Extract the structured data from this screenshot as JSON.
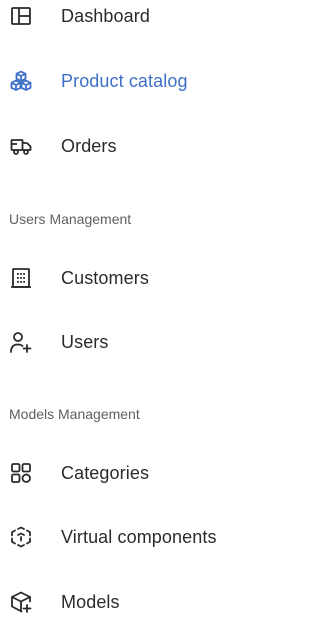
{
  "colors": {
    "text": "#2b2b2b",
    "accent": "#3d6fc8",
    "section_heading": "#5f5f5f",
    "background": "#ffffff"
  },
  "nav": {
    "dashboard": {
      "label": "Dashboard",
      "icon": "dashboard-layout-icon",
      "active": false
    },
    "product_catalog": {
      "label": "Product catalog",
      "icon": "boxes-icon",
      "active": true
    },
    "orders": {
      "label": "Orders",
      "icon": "delivery-truck-icon",
      "active": false
    }
  },
  "sections": {
    "users_management": {
      "title": "Users Management",
      "items": {
        "customers": {
          "label": "Customers",
          "icon": "building-icon"
        },
        "users": {
          "label": "Users",
          "icon": "add-user-icon"
        }
      }
    },
    "models_management": {
      "title": "Models Management",
      "items": {
        "categories": {
          "label": "Categories",
          "icon": "categories-grid-icon"
        },
        "virtual_components": {
          "label": "Virtual components",
          "icon": "virtual-component-icon"
        },
        "models": {
          "label": "Models",
          "icon": "add-model-icon"
        }
      }
    }
  }
}
